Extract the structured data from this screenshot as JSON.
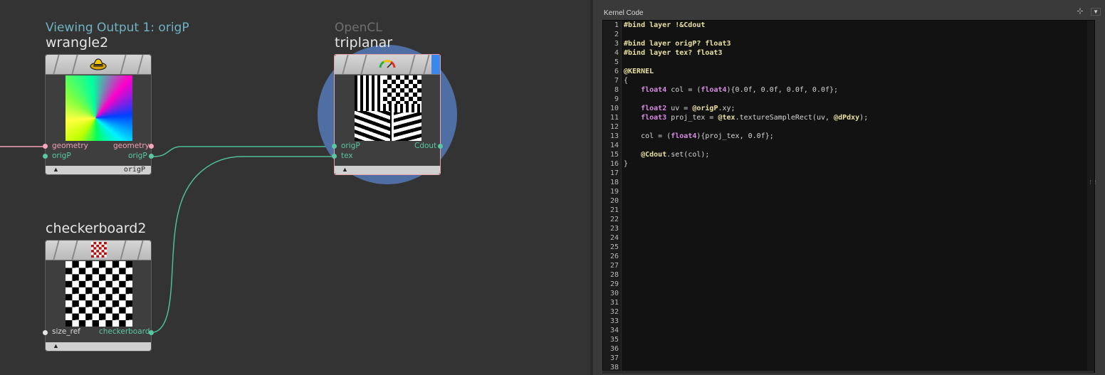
{
  "network": {
    "nodes": {
      "wrangle": {
        "subtitle": "Viewing Output 1: origP",
        "name": "wrangle2",
        "icon": "wrangle-hat-icon",
        "inputs": [
          "geometry",
          "origP"
        ],
        "outputs": [
          "geometry",
          "origP"
        ],
        "footer_label": "origP"
      },
      "opencl": {
        "subtitle": "OpenCL",
        "name": "triplanar",
        "icon": "gauge-icon",
        "inputs": [
          "origP",
          "tex"
        ],
        "outputs": [
          "Cdout"
        ],
        "highlight_color": "#4f6ea3"
      },
      "checker": {
        "name": "checkerboard2",
        "icon": "checkerboard-icon",
        "inputs": [
          "size_ref"
        ],
        "outputs": [
          "checkerboard"
        ]
      }
    },
    "colors": {
      "geometry_wire": "#f4a3ba",
      "layer_wire": "#4fbd98",
      "highlight": "#4f6ea3"
    }
  },
  "panel": {
    "title": "Kernel Code",
    "tools": [
      "pin-plus-icon",
      "dropdown-arrow-icon"
    ],
    "code_lines": [
      "#bind layer !&Cdout",
      "",
      "#bind layer origP? float3",
      "#bind layer tex? float3",
      "",
      "@KERNEL",
      "{",
      "    float4 col = (float4){0.0f, 0.0f, 0.0f, 0.0f};",
      "",
      "    float2 uv = @origP.xy;",
      "    float3 proj_tex = @tex.textureSampleRect(uv, @dPdxy);",
      "",
      "    col = (float4){proj_tex, 0.0f};",
      "",
      "    @Cdout.set(col);",
      "}"
    ],
    "line_count": 38
  }
}
